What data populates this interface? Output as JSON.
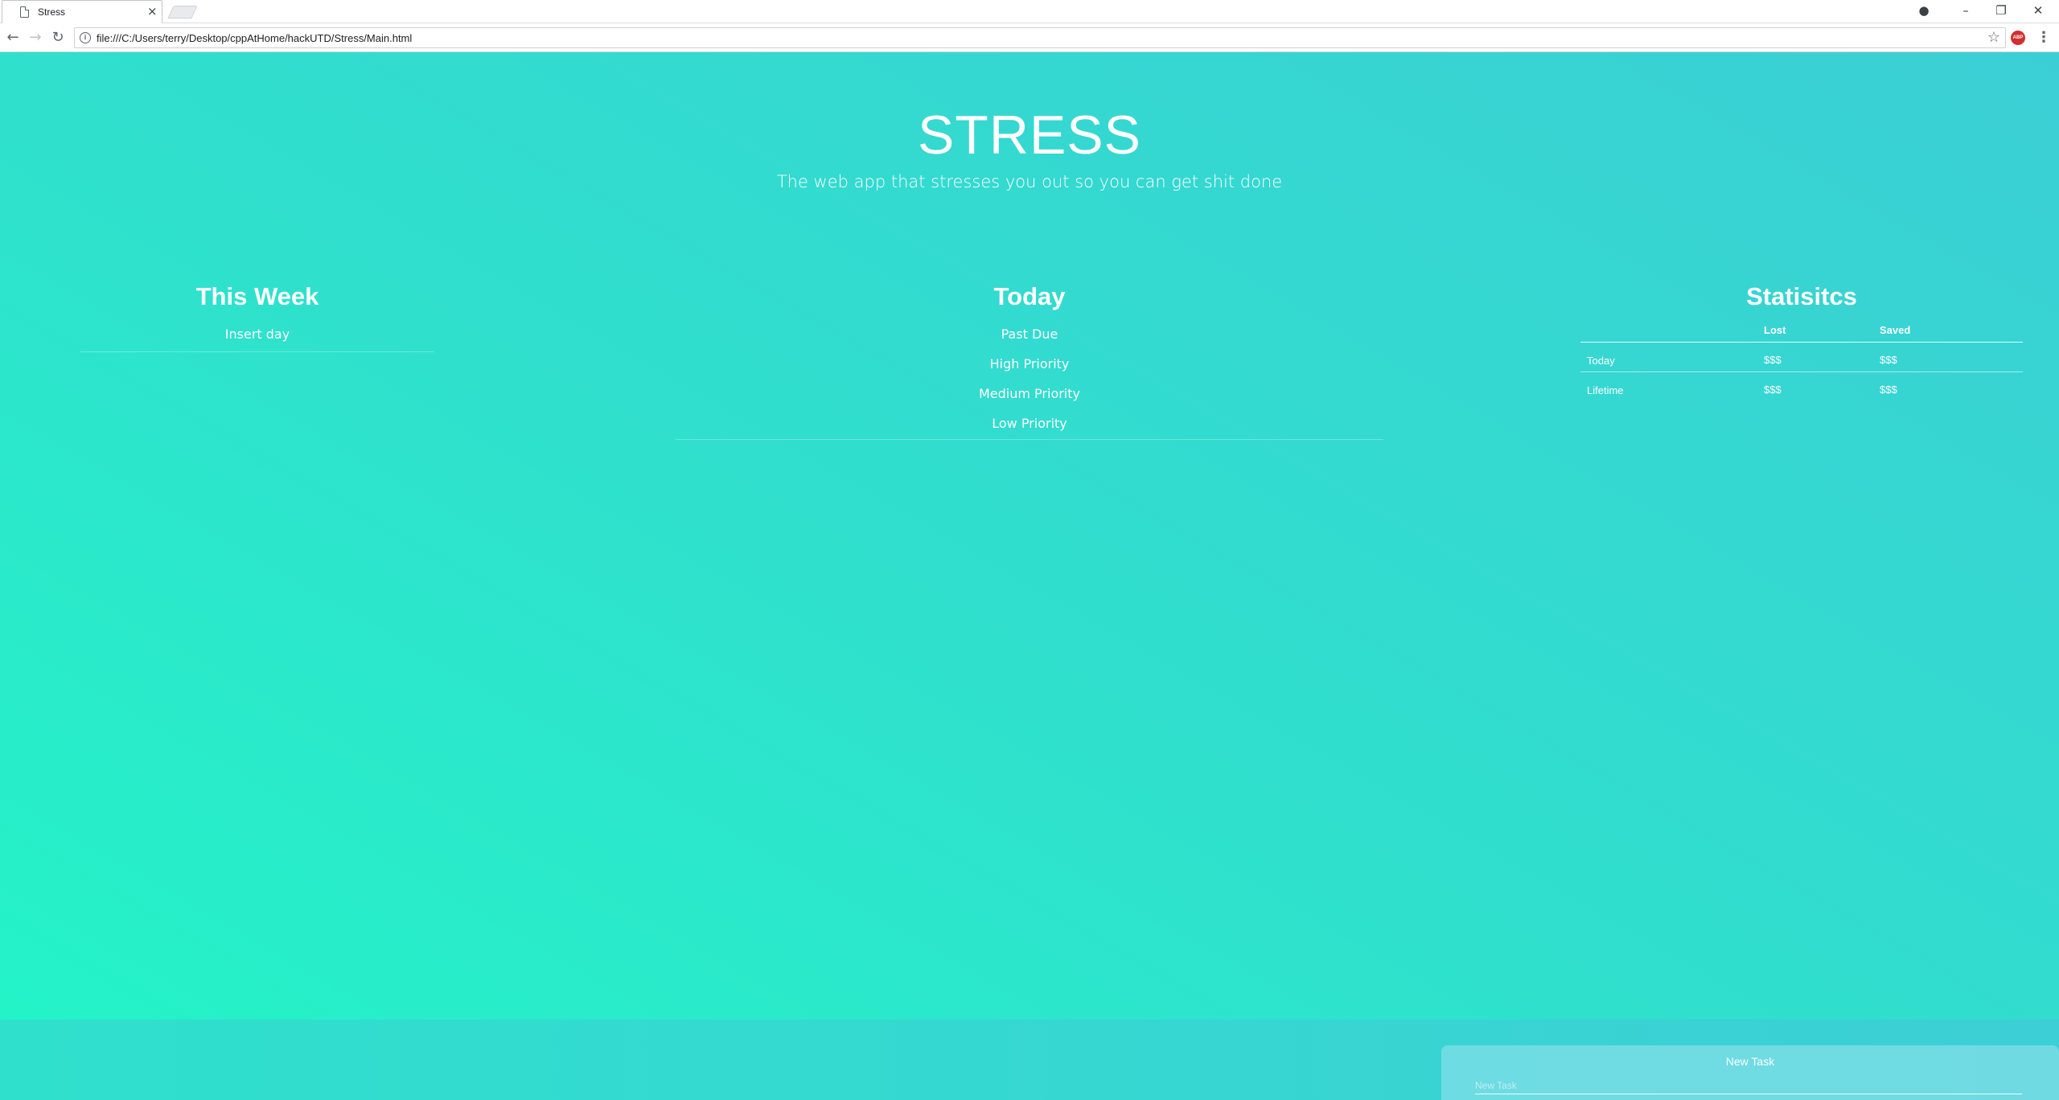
{
  "browser": {
    "tab_title": "Stress",
    "tab_close": "×",
    "url": "file:///C:/Users/terry/Desktop/cppAtHome/hackUTD/Stress/Main.html",
    "nav": {
      "back": "←",
      "forward": "→",
      "reload": "↻"
    },
    "window": {
      "profile": "●",
      "minimize": "–",
      "restore": "❐",
      "close": "✕"
    },
    "star": "☆",
    "extension_label": "ABP",
    "menu": "⋮"
  },
  "header": {
    "title": "STRESS",
    "subtitle": "The web app that stresses you out so you can get shit done"
  },
  "week": {
    "title": "This Week",
    "items": [
      "Insert day"
    ]
  },
  "today": {
    "title": "Today",
    "items": [
      "Past Due",
      "High Priority",
      "Medium Priority",
      "Low Priority"
    ]
  },
  "stats": {
    "title": "Statisitcs",
    "columns": [
      "",
      "Lost",
      "Saved"
    ],
    "rows": [
      {
        "label": "Today",
        "lost": "$$$",
        "saved": "$$$"
      },
      {
        "label": "Lifetime",
        "lost": "$$$",
        "saved": "$$$"
      }
    ]
  },
  "new_task": {
    "title": "New Task",
    "placeholder": "New Task"
  },
  "colors": {
    "gradient_start": "#23f5c7",
    "gradient_end": "#3bcfd5",
    "text": "#ffffff"
  },
  "icons": [
    "page-icon",
    "info-icon",
    "star-icon",
    "adblock-icon",
    "menu-icon",
    "profile-icon"
  ]
}
